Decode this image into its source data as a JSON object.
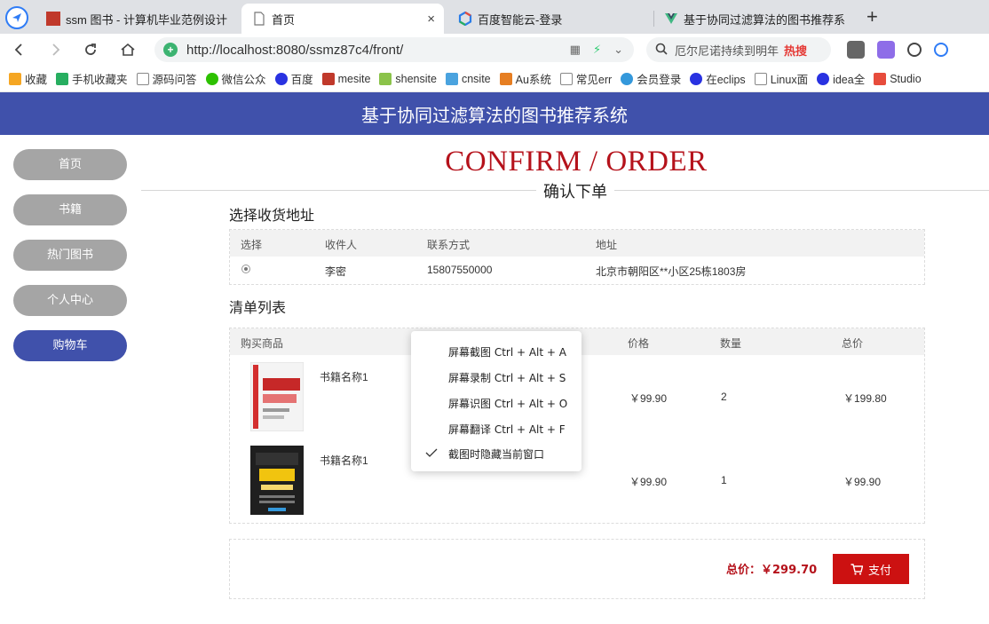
{
  "browser": {
    "tabs": [
      {
        "title": "ssm 图书 - 计算机毕业范例设计",
        "active": false
      },
      {
        "title": "首页",
        "active": true
      },
      {
        "title": "百度智能云-登录",
        "active": false
      },
      {
        "title": "基于协同过滤算法的图书推荐系",
        "active": false
      }
    ],
    "close_glyph": "×",
    "new_tab_glyph": "+",
    "url": "http://localhost:8080/ssmz87c4/front/",
    "search_text": "厄尔尼诺持续到明年",
    "search_hot": "热搜",
    "bookmarks": [
      "收藏",
      "手机收藏夹",
      "源码问答",
      "微信公众",
      "百度",
      "mesite",
      "shensite",
      "cnsite",
      "Au系统",
      "常见err",
      "会员登录",
      "在eclips",
      "Linux面",
      "idea全",
      "Studio"
    ]
  },
  "site": {
    "title": "基于协同过滤算法的图书推荐系统",
    "nav": [
      "首页",
      "书籍",
      "热门图书",
      "个人中心",
      "购物车"
    ],
    "active_nav_index": 4
  },
  "page": {
    "heading_en": "CONFIRM / ORDER",
    "heading_cn": "确认下单"
  },
  "address": {
    "section_title": "选择收货地址",
    "headers": [
      "选择",
      "收件人",
      "联系方式",
      "地址"
    ],
    "rows": [
      {
        "name": "李密",
        "phone": "15807550000",
        "address": "北京市朝阳区**小区25栋1803房"
      }
    ]
  },
  "cart": {
    "section_title": "清单列表",
    "headers": [
      "购买商品",
      "价格",
      "数量",
      "总价"
    ],
    "items": [
      {
        "name": "书籍名称1",
        "price": "￥99.90",
        "qty": "2",
        "total": "￥199.80"
      },
      {
        "name": "书籍名称1",
        "price": "￥99.90",
        "qty": "1",
        "total": "￥99.90"
      }
    ]
  },
  "summary": {
    "total_label": "总价：￥299.70",
    "pay_label": "支付"
  },
  "context_menu": {
    "items": [
      "屏幕截图 Ctrl + Alt + A",
      "屏幕录制 Ctrl + Alt + S",
      "屏幕识图 Ctrl + Alt + O",
      "屏幕翻译 Ctrl + Alt + F",
      "截图时隐藏当前窗口"
    ],
    "checked_index": 4
  },
  "colors": {
    "brand": "#4051ab",
    "accent_red": "#b5121b",
    "pay_button": "#cc1111",
    "nav_inactive": "#a5a5a5"
  }
}
